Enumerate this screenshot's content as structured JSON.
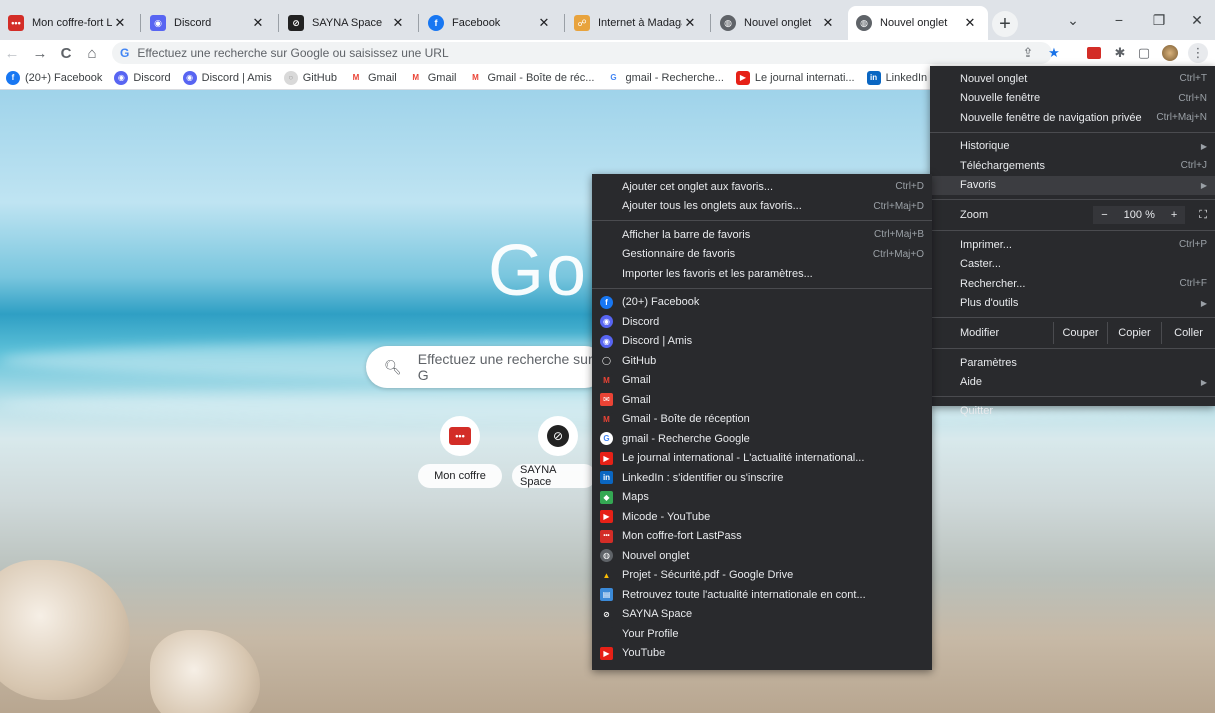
{
  "tabs": [
    {
      "title": "Mon coffre-fort La",
      "fav_color": "#d32d27",
      "fav_glyph": "•••"
    },
    {
      "title": "Discord",
      "fav_color": "#5865f2",
      "fav_glyph": "◉"
    },
    {
      "title": "SAYNA Space",
      "fav_color": "#222222",
      "fav_glyph": "⊘"
    },
    {
      "title": "Facebook",
      "fav_color": "#1877f2",
      "fav_glyph": "f"
    },
    {
      "title": "Internet à Madagas",
      "fav_color": "#e8a33d",
      "fav_glyph": "☍"
    },
    {
      "title": "Nouvel onglet",
      "fav_color": "#5f6368",
      "fav_glyph": "◍"
    },
    {
      "title": "Nouvel onglet",
      "fav_color": "#5f6368",
      "fav_glyph": "◍"
    }
  ],
  "window": {
    "minimize": "−",
    "restore": "❐",
    "close": "✕",
    "tab_search": "⌄",
    "new_tab": "+"
  },
  "toolbar": {
    "back": "←",
    "forward": "→",
    "reload": "C",
    "home": "⌂",
    "omnibox_placeholder": "Effectuez une recherche sur Google ou saisissez une URL",
    "g": "G"
  },
  "bookmarks_bar": [
    {
      "label": "(20+) Facebook",
      "color": "#1877f2",
      "glyph": "f"
    },
    {
      "label": "Discord",
      "color": "#5865f2",
      "glyph": "◉"
    },
    {
      "label": "Discord | Amis",
      "color": "#5865f2",
      "glyph": "◉"
    },
    {
      "label": "GitHub",
      "color": "#d9d9d9",
      "glyph": "○"
    },
    {
      "label": "Gmail",
      "color": "#ffffff",
      "glyph": "M"
    },
    {
      "label": "Gmail",
      "color": "#ffffff",
      "glyph": "M"
    },
    {
      "label": "Gmail - Boîte de réc...",
      "color": "#ffffff",
      "glyph": "M"
    },
    {
      "label": "gmail - Recherche...",
      "color": "#ffffff",
      "glyph": "G"
    },
    {
      "label": "Le journal internati...",
      "color": "#e62117",
      "glyph": "▶"
    },
    {
      "label": "LinkedIn : s'ide",
      "color": "#0a66c2",
      "glyph": "in"
    }
  ],
  "ntp": {
    "logo": "Go",
    "search_placeholder": "Effectuez une recherche sur G",
    "shortcuts": [
      {
        "label": "Mon coffre",
        "color": "#d32d27",
        "glyph": "•••"
      },
      {
        "label": "SAYNA Space",
        "color": "#222222",
        "glyph": "⊘"
      }
    ]
  },
  "main_menu": {
    "group1": [
      {
        "label": "Nouvel onglet",
        "acc": "Ctrl+T"
      },
      {
        "label": "Nouvelle fenêtre",
        "acc": "Ctrl+N"
      },
      {
        "label": "Nouvelle fenêtre de navigation privée",
        "acc": "Ctrl+Maj+N"
      }
    ],
    "group2": [
      {
        "label": "Historique",
        "acc": "▶"
      },
      {
        "label": "Téléchargements",
        "acc": "Ctrl+J"
      },
      {
        "label": "Favoris",
        "acc": "▶"
      }
    ],
    "zoom": {
      "label": "Zoom",
      "minus": "−",
      "value": "100 %",
      "plus": "+",
      "fullscreen": "⛶"
    },
    "group3": [
      {
        "label": "Imprimer...",
        "acc": "Ctrl+P"
      },
      {
        "label": "Caster...",
        "acc": ""
      },
      {
        "label": "Rechercher...",
        "acc": "Ctrl+F"
      },
      {
        "label": "Plus d'outils",
        "acc": "▶"
      }
    ],
    "edit": {
      "label": "Modifier",
      "cut": "Couper",
      "copy": "Copier",
      "paste": "Coller"
    },
    "group4": [
      {
        "label": "Paramètres",
        "acc": ""
      },
      {
        "label": "Aide",
        "acc": "▶"
      }
    ],
    "quit": "Quitter"
  },
  "favorites_menu": {
    "actions1": [
      {
        "label": "Ajouter cet onglet aux favoris...",
        "acc": "Ctrl+D"
      },
      {
        "label": "Ajouter tous les onglets aux favoris...",
        "acc": "Ctrl+Maj+D"
      }
    ],
    "actions2": [
      {
        "label": "Afficher la barre de favoris",
        "acc": "Ctrl+Maj+B"
      },
      {
        "label": "Gestionnaire de favoris",
        "acc": "Ctrl+Maj+O"
      },
      {
        "label": "Importer les favoris et les paramètres...",
        "acc": ""
      }
    ],
    "items": [
      {
        "label": "(20+) Facebook",
        "color": "#1877f2",
        "glyph": "f"
      },
      {
        "label": "Discord",
        "color": "#5865f2",
        "glyph": "◉"
      },
      {
        "label": "Discord | Amis",
        "color": "#5865f2",
        "glyph": "◉"
      },
      {
        "label": "GitHub",
        "color": "#292a2d",
        "glyph": "◯"
      },
      {
        "label": "Gmail",
        "color": "#292a2d",
        "glyph": "M"
      },
      {
        "label": "Gmail",
        "color": "#ea4335",
        "glyph": "✉"
      },
      {
        "label": "Gmail - Boîte de réception",
        "color": "#292a2d",
        "glyph": "M"
      },
      {
        "label": "gmail - Recherche Google",
        "color": "#ffffff",
        "glyph": "G"
      },
      {
        "label": "Le journal international - L'actualité international...",
        "color": "#e62117",
        "glyph": "▶"
      },
      {
        "label": "LinkedIn : s'identifier ou s'inscrire",
        "color": "#0a66c2",
        "glyph": "in"
      },
      {
        "label": "Maps",
        "color": "#34a853",
        "glyph": "◆"
      },
      {
        "label": "Micode - YouTube",
        "color": "#e62117",
        "glyph": "▶"
      },
      {
        "label": "Mon coffre-fort LastPass",
        "color": "#d32d27",
        "glyph": "•••"
      },
      {
        "label": "Nouvel onglet",
        "color": "#5f6368",
        "glyph": "◍"
      },
      {
        "label": "Projet - Sécurité.pdf - Google Drive",
        "color": "#292a2d",
        "glyph": "▲"
      },
      {
        "label": "Retrouvez toute l'actualité internationale en cont...",
        "color": "#3b8ad8",
        "glyph": "▤"
      },
      {
        "label": "SAYNA Space",
        "color": "#292a2d",
        "glyph": "⊘"
      },
      {
        "label": "Your Profile",
        "color": "#292a2d",
        "glyph": ""
      },
      {
        "label": "YouTube",
        "color": "#e62117",
        "glyph": "▶"
      }
    ]
  }
}
